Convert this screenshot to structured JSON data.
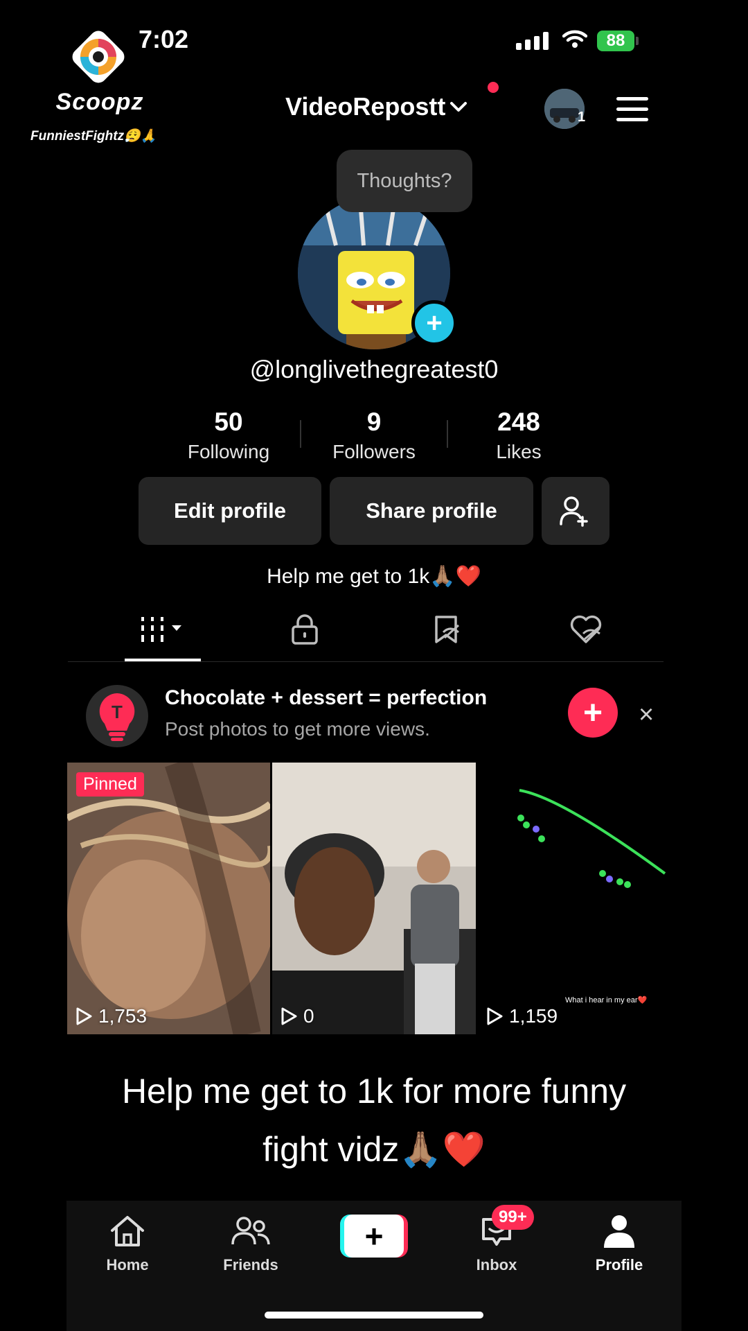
{
  "status_bar": {
    "time": "7:02",
    "battery": "88"
  },
  "watermark": {
    "brand": "Scoopz",
    "channel": "FunniestFightz😮‍💨🙏"
  },
  "header": {
    "account_name": "VideoRepostt",
    "account_count": "1"
  },
  "profile": {
    "tooltip": "Thoughts?",
    "username": "@longlivethegreatest0",
    "bio": "Help me get to 1k🙏🏽❤️",
    "stats": [
      {
        "value": "50",
        "label": "Following"
      },
      {
        "value": "9",
        "label": "Followers"
      },
      {
        "value": "248",
        "label": "Likes"
      }
    ],
    "edit_label": "Edit profile",
    "share_label": "Share profile"
  },
  "promo": {
    "title": "Chocolate + dessert = perfection",
    "subtitle": "Post photos to get more views.",
    "icon_letter": "T",
    "close": "×"
  },
  "videos": [
    {
      "views": "1,753",
      "badge": "Pinned"
    },
    {
      "views": "0"
    },
    {
      "views": "1,159",
      "overlay_text": "What i hear in my ear❤️"
    }
  ],
  "caption": {
    "line1": "Help me get to 1k for more funny",
    "line2": "fight vidz🙏🏽❤️"
  },
  "nav": {
    "home": "Home",
    "friends": "Friends",
    "inbox": "Inbox",
    "inbox_badge": "99+",
    "profile": "Profile",
    "create_symbol": "+"
  },
  "colors": {
    "accent": "#fe2c55",
    "cyan": "#25f4ee",
    "avatar_plus": "#22c4e6"
  }
}
